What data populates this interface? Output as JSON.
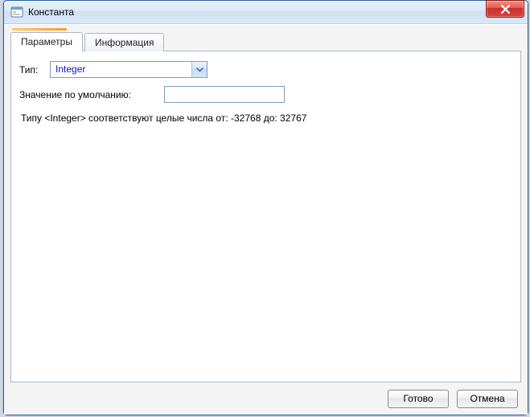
{
  "window": {
    "title": "Константа"
  },
  "tabs": {
    "params": "Параметры",
    "info": "Информация"
  },
  "form": {
    "type_label": "Тип:",
    "type_value": "Integer",
    "default_label": "Значение по умолчанию:",
    "default_value": "",
    "description": "Типу <Integer> соответствуют целые числа от: -32768 до: 32767"
  },
  "buttons": {
    "ok": "Готово",
    "cancel": "Отмена"
  }
}
